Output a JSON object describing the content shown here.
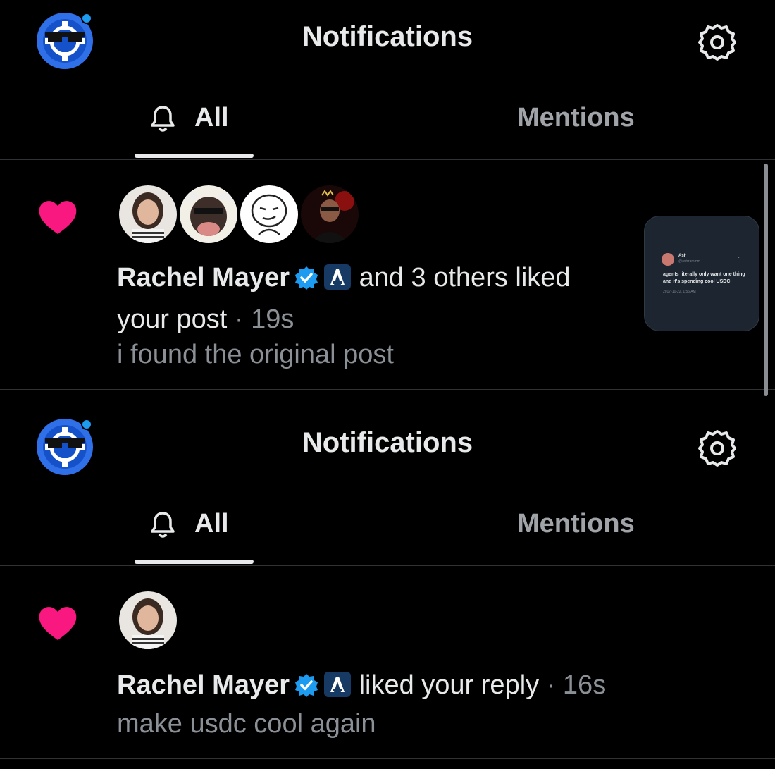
{
  "header": {
    "title": "Notifications"
  },
  "tabs": [
    {
      "label": "All"
    },
    {
      "label": "Mentions"
    }
  ],
  "notifications": [
    {
      "actor": "Rachel Mayer",
      "action": "and 3 others liked",
      "action_line2": "your post",
      "time": "19s",
      "preview": "i found the original post",
      "thumbnail": {
        "name": "Ash",
        "handle": "@ashzammm",
        "body": "agents literally only want one thing and it's spending cool USDC",
        "date": "2017-10-22, 1:56 AM"
      }
    },
    {
      "actor": "Rachel Mayer",
      "action": "liked your reply",
      "time": "16s",
      "preview": "make usdc cool again"
    }
  ],
  "separator": "·",
  "colors": {
    "like": "#f91880",
    "verified": "#1d9bf0",
    "accent_blue": "#1d6fe0"
  },
  "icons": [
    "app-logo-icon",
    "gear-icon",
    "bell-icon",
    "heart-icon",
    "verified-badge-icon",
    "affiliate-badge-icon"
  ]
}
